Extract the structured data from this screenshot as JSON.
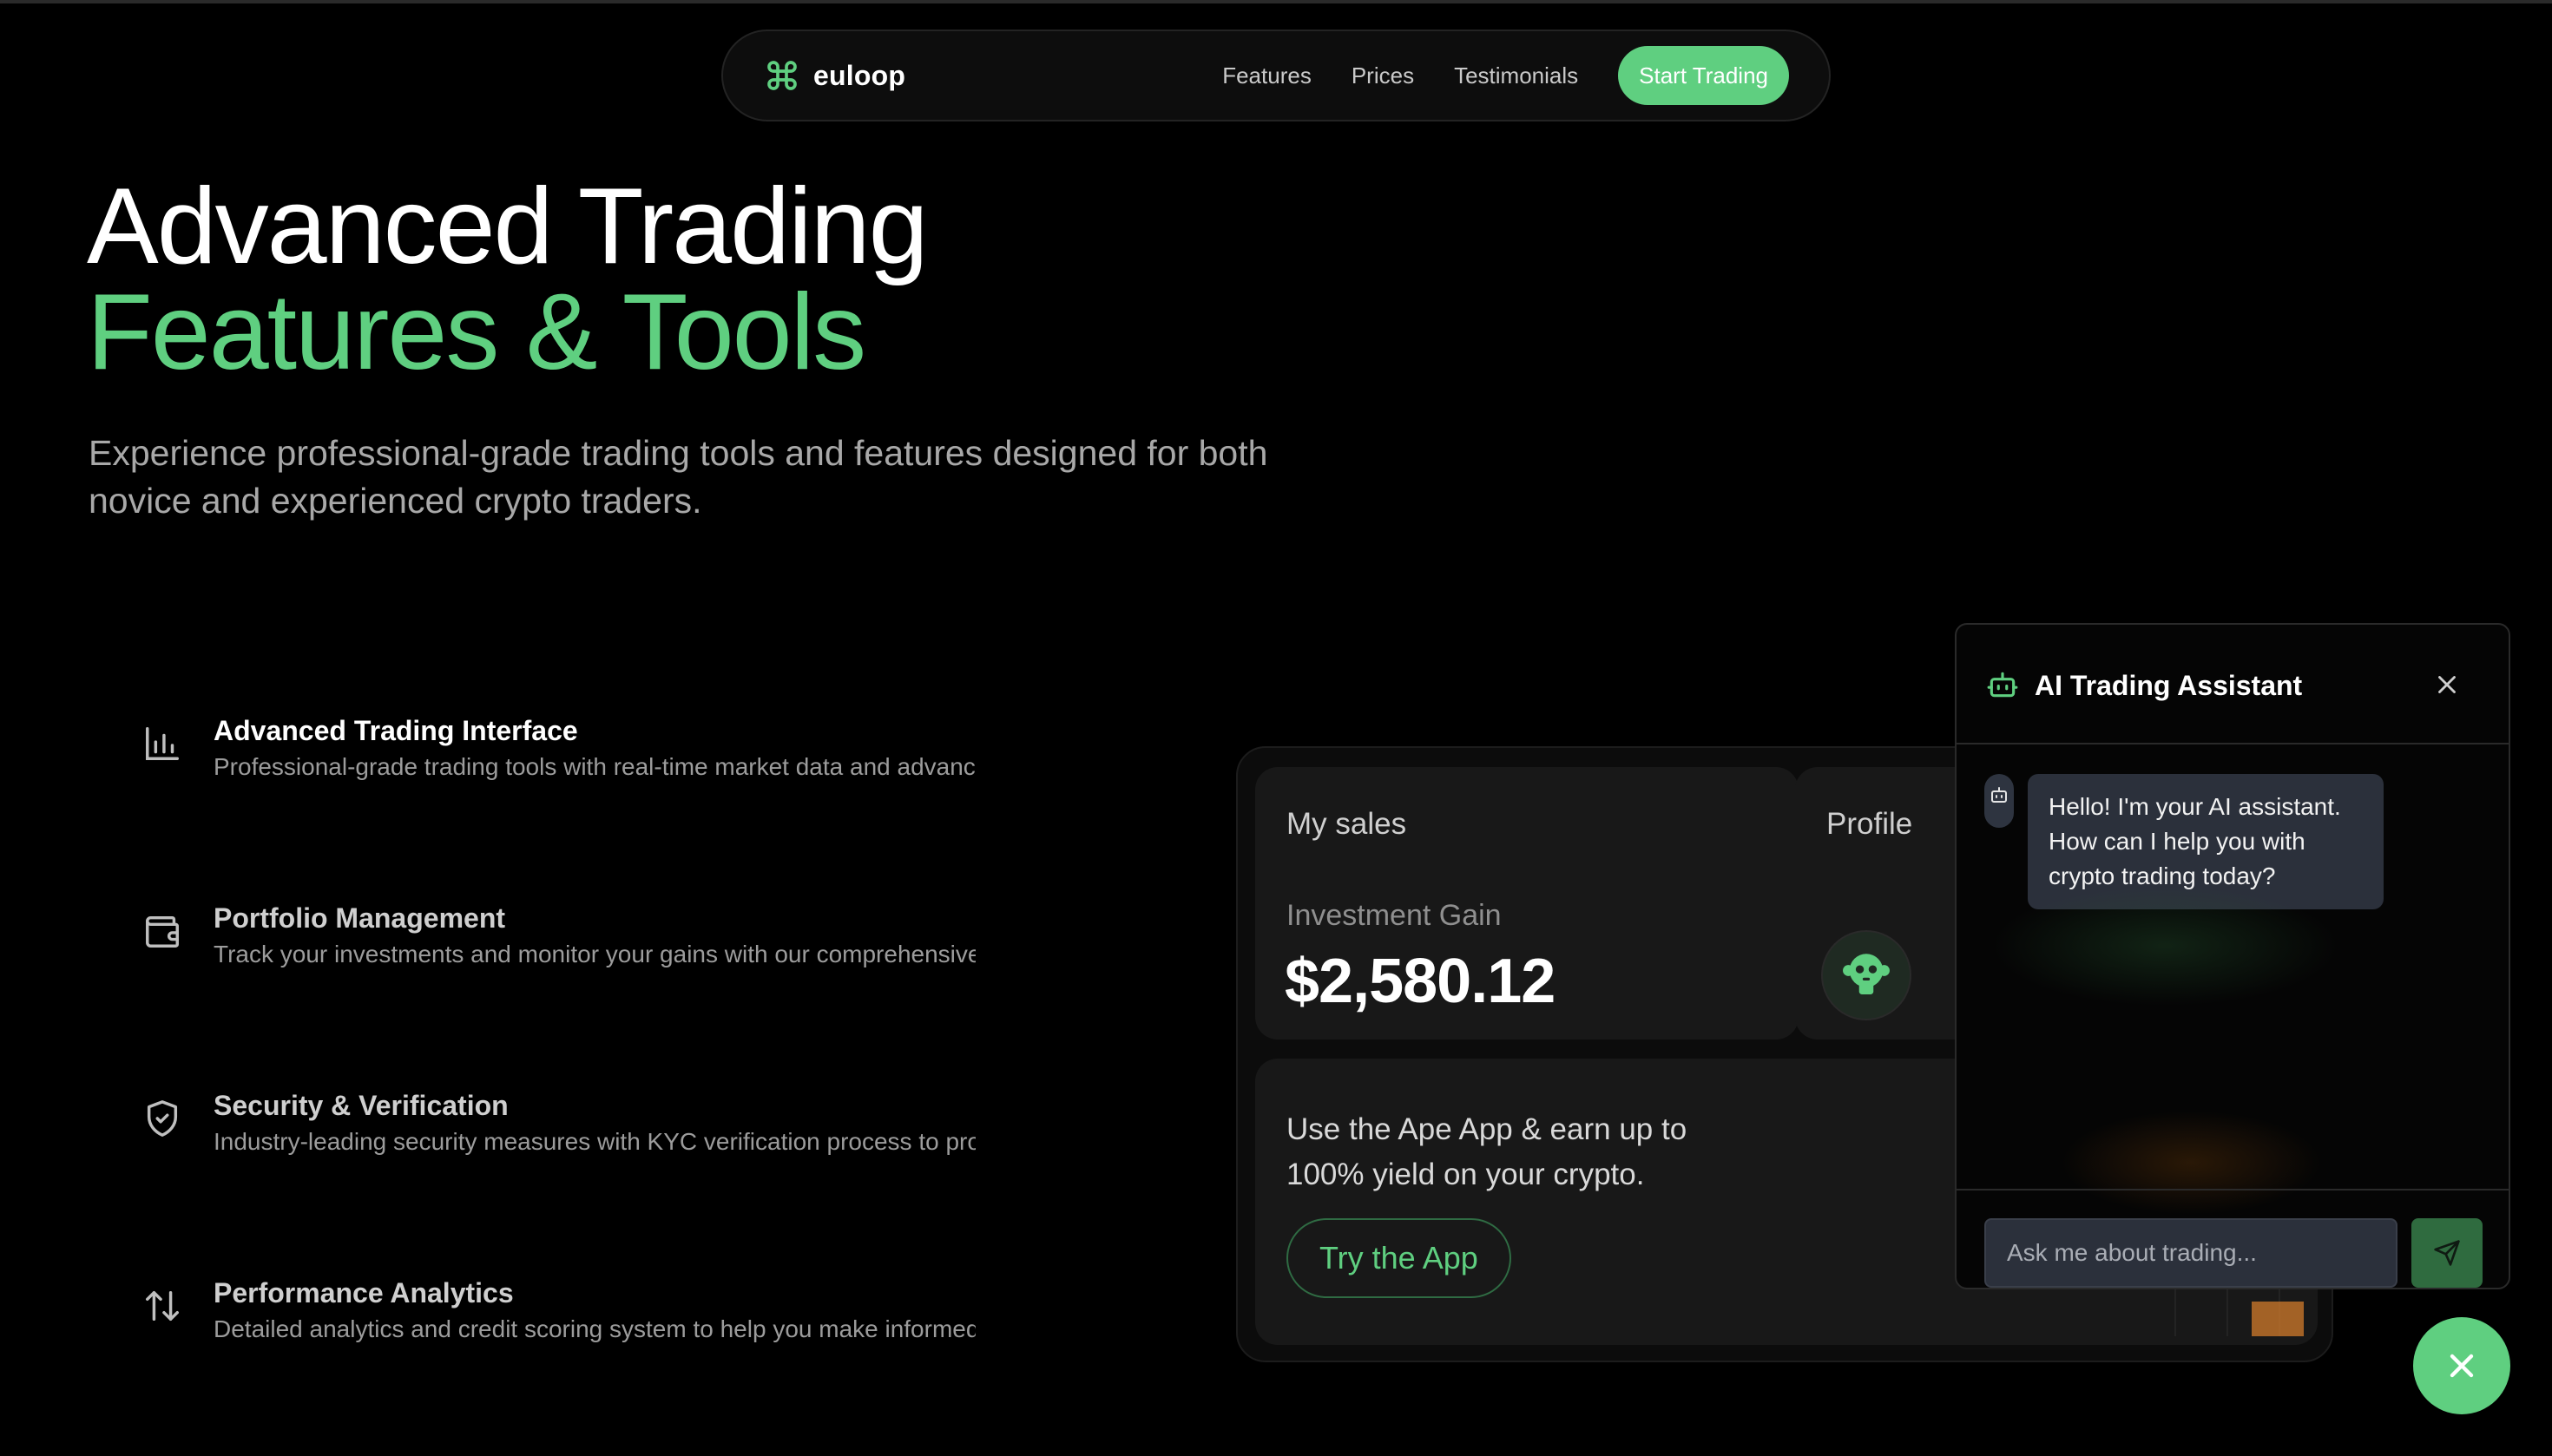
{
  "brand": {
    "name": "euloop",
    "icon": "command-icon"
  },
  "nav": {
    "links": [
      "Features",
      "Prices",
      "Testimonials"
    ],
    "cta": "Start Trading"
  },
  "hero": {
    "title_line1": "Advanced Trading",
    "title_line2": "Features & Tools",
    "subtitle_line1": "Experience professional-grade trading tools and features designed for both",
    "subtitle_line2": "novice and experienced crypto traders."
  },
  "features": [
    {
      "icon": "bar-chart-icon",
      "title": "Advanced Trading Interface",
      "desc": "Professional-grade trading tools with real-time market data and advanced charting capabilities."
    },
    {
      "icon": "wallet-icon",
      "title": "Portfolio Management",
      "desc": "Track your investments and monitor your gains with our comprehensive portfolio tools."
    },
    {
      "icon": "shield-check-icon",
      "title": "Security & Verification",
      "desc": "Industry-leading security measures with KYC verification process to protect your assets."
    },
    {
      "icon": "arrows-up-down-icon",
      "title": "Performance Analytics",
      "desc": "Detailed analytics and credit scoring system to help you make informed decisions."
    }
  ],
  "dashboard": {
    "sales_title": "My sales",
    "gain_label": "Investment Gain",
    "gain_value": "$2,580.12",
    "profile_title": "Profile",
    "ape_text": "Use the Ape App & earn up to 100% yield on your crypto.",
    "ape_button": "Try the App"
  },
  "chat": {
    "title": "AI Trading Assistant",
    "message": "Hello! I'm your AI assistant. How can I help you with crypto trading today?",
    "input_placeholder": "Ask me about trading..."
  },
  "colors": {
    "accent": "#5fcf80",
    "background": "#000000",
    "card": "#181818"
  }
}
